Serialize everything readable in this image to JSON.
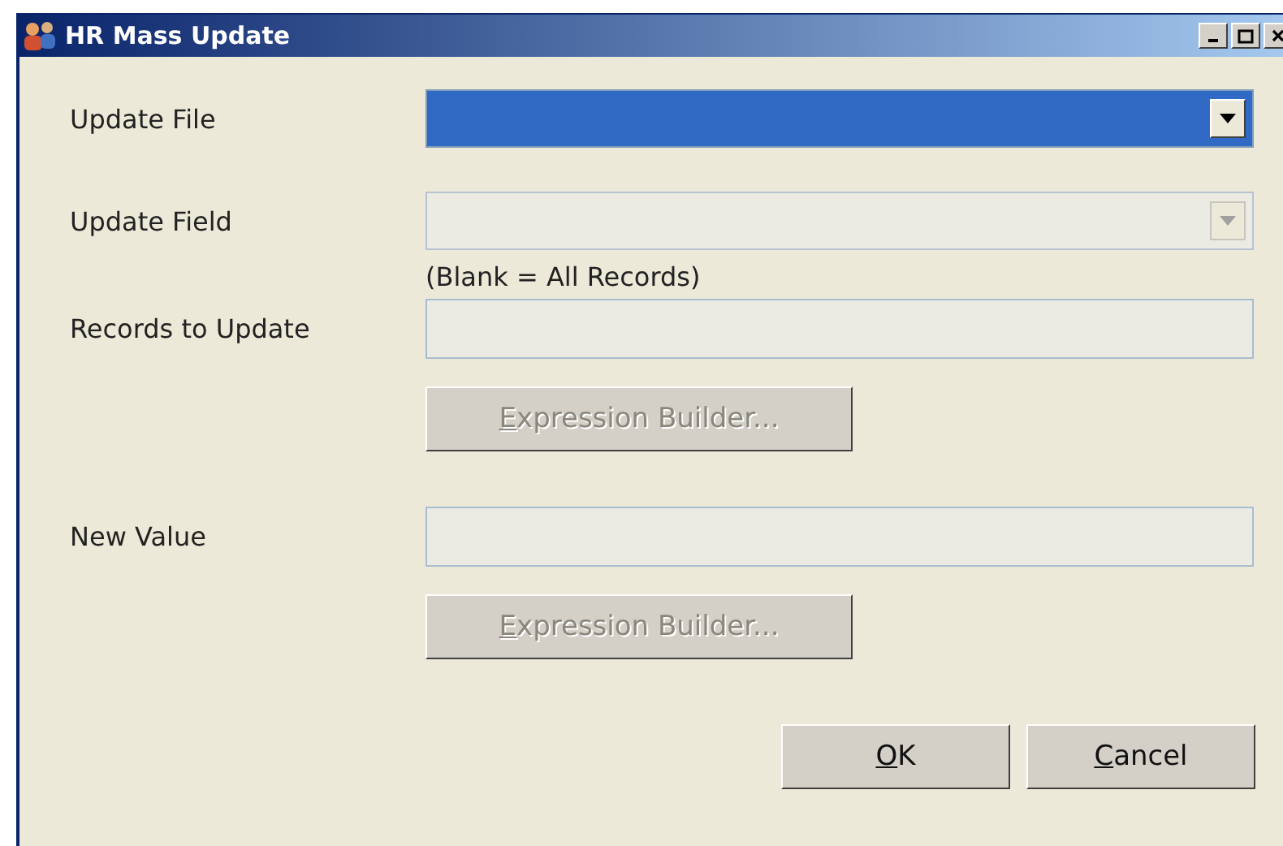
{
  "window": {
    "title": "HR Mass Update"
  },
  "fields": [
    {
      "kind": "combo",
      "label": "Update File",
      "selected": true,
      "disabled": false
    },
    {
      "kind": "combo",
      "label": "Update Field",
      "selected": false,
      "disabled": true
    },
    {
      "kind": "text",
      "note": "(Blank = All Records)",
      "label": "Records to Update",
      "disabled": true,
      "button": {
        "label": "Expression Builder...",
        "disabled": true
      }
    },
    {
      "kind": "text",
      "label": "New Value",
      "disabled": true,
      "button": {
        "label": "Expression Builder...",
        "disabled": true
      }
    }
  ],
  "buttons": [
    {
      "label": "OK"
    },
    {
      "label": "Cancel"
    }
  ]
}
